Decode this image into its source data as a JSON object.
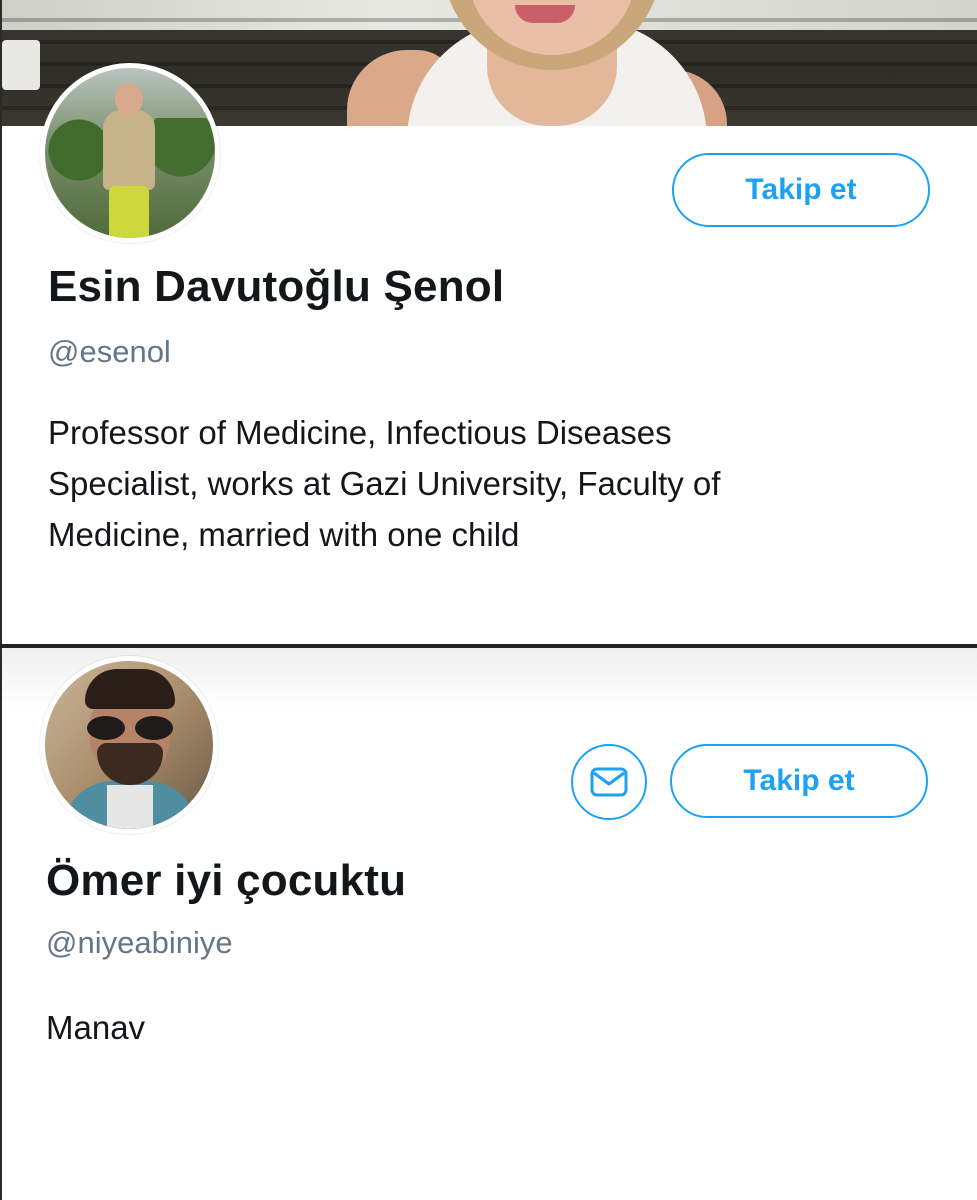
{
  "profiles": [
    {
      "display_name": "Esin Davutoğlu Şenol",
      "handle": "@esenol",
      "bio_lines": [
        "Professor of Medicine, Infectious Diseases",
        "Specialist, works at Gazi University, Faculty of",
        "Medicine, married with one child"
      ],
      "follow_label": "Takip et"
    },
    {
      "display_name": "Ömer iyi çocuktu",
      "handle": "@niyeabiniye",
      "bio_lines": [
        "Manav"
      ],
      "follow_label": "Takip et",
      "message_icon": "envelope-icon"
    }
  ],
  "colors": {
    "accent": "#1da1f2",
    "name_text": "#14171a",
    "handle_text": "#657786"
  }
}
